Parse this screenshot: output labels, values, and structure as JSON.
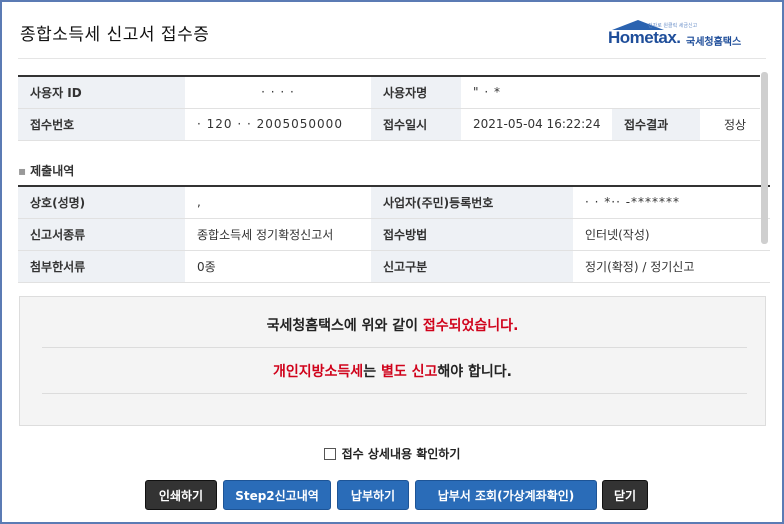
{
  "page": {
    "title": "종합소득세 신고서 접수증",
    "logo_brand": "Hometax.",
    "logo_brand_ko": "국세청홈택스",
    "logo_tagline": "전자로 원클릭 세금신고"
  },
  "receipt": {
    "user_id_label": "사용자 ID",
    "user_id_value": "· · · ·",
    "user_name_label": "사용자명",
    "user_name_value": "\" ·  *",
    "receipt_no_label": "접수번호",
    "receipt_no_value": "· 120 ·            · 2005050000",
    "receipt_date_label": "접수일시",
    "receipt_date_value": "2021-05-04 16:22:24",
    "receipt_result_label": "접수결과",
    "receipt_result_value": "정상"
  },
  "submission": {
    "section_title": "제출내역",
    "trade_name_label": "상호(성명)",
    "trade_name_value": ",",
    "reg_no_label": "사업자(주민)등록번호",
    "reg_no_value": "· · *·· -*******",
    "form_type_label": "신고서종류",
    "form_type_value": "종합소득세 정기확정신고서",
    "method_label": "접수방법",
    "method_value": "인터넷(작성)",
    "attachments_label": "첨부한서류",
    "attachments_value": "0종",
    "filing_type_label": "신고구분",
    "filing_type_value": "정기(확정) / 정기신고"
  },
  "notice": {
    "line1_prefix": "국세청홈택스에 위와 같이 ",
    "line1_highlight": "접수되었습니다.",
    "line2_highlight1": "개인지방소득세",
    "line2_middle": "는 ",
    "line2_highlight2": "별도 신고",
    "line2_suffix": "해야 합니다."
  },
  "detail_check": {
    "label": "접수 상세내용 확인하기",
    "checked": false
  },
  "buttons": {
    "print": "인쇄하기",
    "step2": "Step2신고내역",
    "pay": "납부하기",
    "bill_inquiry": "납부서 조회(가상계좌확인)",
    "close": "닫기"
  },
  "colors": {
    "accent_blue": "#2a6cb8",
    "highlight_red": "#d0021b",
    "label_bg": "#eef1f5"
  }
}
